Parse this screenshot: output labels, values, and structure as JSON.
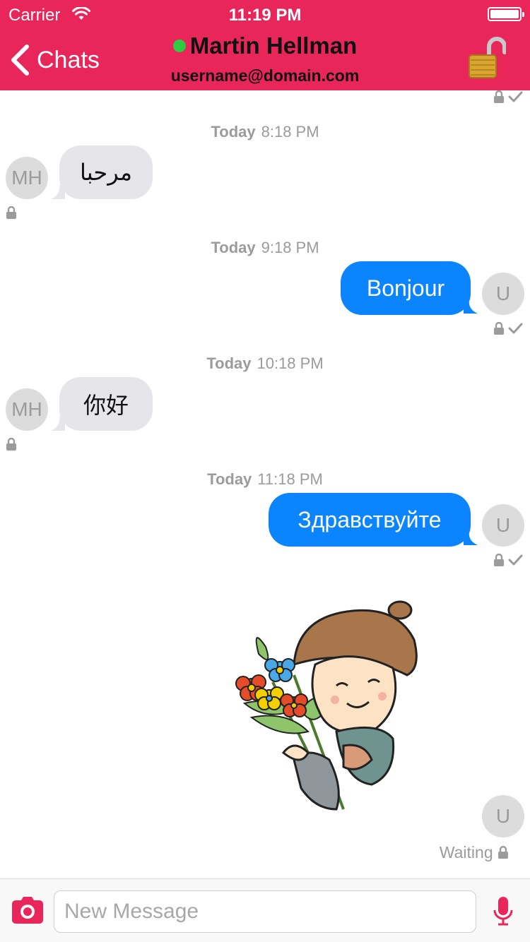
{
  "status_bar": {
    "carrier": "Carrier",
    "time": "11:19 PM",
    "wifi_icon": "wifi-icon",
    "battery_icon": "battery-icon"
  },
  "nav": {
    "back_label": "Chats",
    "contact_name": "Martin Hellman",
    "contact_email": "username@domain.com",
    "online_color": "#2ecc40",
    "encryption_icon": "open-padlock-icon"
  },
  "theme": {
    "accent": "#e8265a",
    "outgoing_bubble": "#0a84ff",
    "incoming_bubble": "#e6e5ea"
  },
  "messages": [
    {
      "day": "Today",
      "time": "8:18 PM",
      "direction": "incoming",
      "avatar": "MH",
      "text": "مرحبا"
    },
    {
      "day": "Today",
      "time": "9:18 PM",
      "direction": "outgoing",
      "avatar": "U",
      "text": "Bonjour"
    },
    {
      "day": "Today",
      "time": "10:18 PM",
      "direction": "incoming",
      "avatar": "MH",
      "text": "你好"
    },
    {
      "day": "Today",
      "time": "11:18 PM",
      "direction": "outgoing",
      "avatar": "U",
      "text": "Здравствуйте"
    },
    {
      "direction": "outgoing",
      "avatar": "U",
      "type": "sticker",
      "status": "Waiting"
    }
  ],
  "composer": {
    "placeholder": "New Message",
    "camera_icon": "camera-icon",
    "mic_icon": "microphone-icon"
  }
}
